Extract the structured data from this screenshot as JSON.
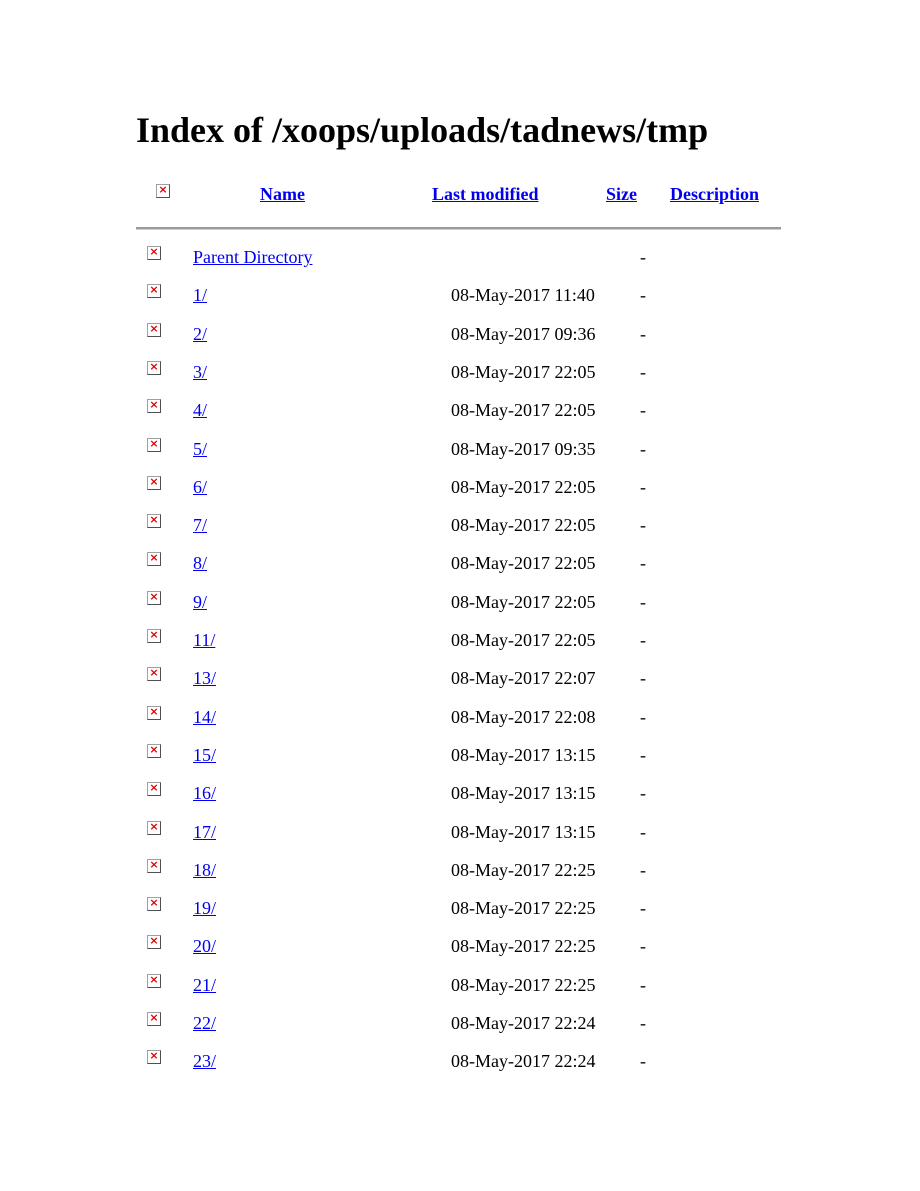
{
  "page": {
    "title": "Index of /xoops/uploads/tadnews/tmp"
  },
  "header": {
    "icon": "broken-image-icon",
    "name_label": "Name",
    "last_modified_label": "Last modified",
    "size_label": "Size",
    "description_label": "Description"
  },
  "entries": [
    {
      "name": "Parent Directory",
      "modified": "",
      "size": "-",
      "icon": "broken-image-icon"
    },
    {
      "name": "1/",
      "modified": "08-May-2017 11:40",
      "size": "-",
      "icon": "broken-image-icon"
    },
    {
      "name": "2/",
      "modified": "08-May-2017 09:36",
      "size": "-",
      "icon": "broken-image-icon"
    },
    {
      "name": "3/",
      "modified": "08-May-2017 22:05",
      "size": "-",
      "icon": "broken-image-icon"
    },
    {
      "name": "4/",
      "modified": "08-May-2017 22:05",
      "size": "-",
      "icon": "broken-image-icon"
    },
    {
      "name": "5/",
      "modified": "08-May-2017 09:35",
      "size": "-",
      "icon": "broken-image-icon"
    },
    {
      "name": "6/",
      "modified": "08-May-2017 22:05",
      "size": "-",
      "icon": "broken-image-icon"
    },
    {
      "name": "7/",
      "modified": "08-May-2017 22:05",
      "size": "-",
      "icon": "broken-image-icon"
    },
    {
      "name": "8/",
      "modified": "08-May-2017 22:05",
      "size": "-",
      "icon": "broken-image-icon"
    },
    {
      "name": "9/",
      "modified": "08-May-2017 22:05",
      "size": "-",
      "icon": "broken-image-icon"
    },
    {
      "name": "11/",
      "modified": "08-May-2017 22:05",
      "size": "-",
      "icon": "broken-image-icon"
    },
    {
      "name": "13/",
      "modified": "08-May-2017 22:07",
      "size": "-",
      "icon": "broken-image-icon"
    },
    {
      "name": "14/",
      "modified": "08-May-2017 22:08",
      "size": "-",
      "icon": "broken-image-icon"
    },
    {
      "name": "15/",
      "modified": "08-May-2017 13:15",
      "size": "-",
      "icon": "broken-image-icon"
    },
    {
      "name": "16/",
      "modified": "08-May-2017 13:15",
      "size": "-",
      "icon": "broken-image-icon"
    },
    {
      "name": "17/",
      "modified": "08-May-2017 13:15",
      "size": "-",
      "icon": "broken-image-icon"
    },
    {
      "name": "18/",
      "modified": "08-May-2017 22:25",
      "size": "-",
      "icon": "broken-image-icon"
    },
    {
      "name": "19/",
      "modified": "08-May-2017 22:25",
      "size": "-",
      "icon": "broken-image-icon"
    },
    {
      "name": "20/",
      "modified": "08-May-2017 22:25",
      "size": "-",
      "icon": "broken-image-icon"
    },
    {
      "name": "21/",
      "modified": "08-May-2017 22:25",
      "size": "-",
      "icon": "broken-image-icon"
    },
    {
      "name": "22/",
      "modified": "08-May-2017 22:24",
      "size": "-",
      "icon": "broken-image-icon"
    },
    {
      "name": "23/",
      "modified": "08-May-2017 22:24",
      "size": "-",
      "icon": "broken-image-icon"
    }
  ],
  "colors": {
    "link": "#0000ee",
    "rule": "#9a9a9a",
    "broken_icon_x": "#e00000"
  }
}
